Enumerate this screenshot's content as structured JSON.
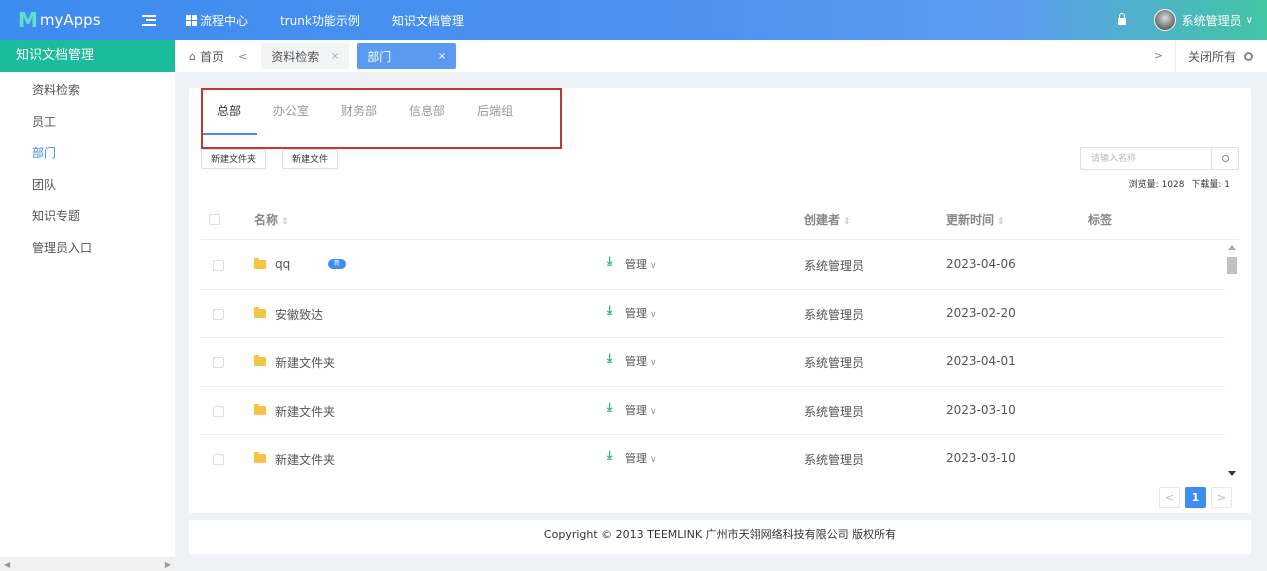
{
  "app": {
    "logo_mark": "M",
    "name": "myApps"
  },
  "topnav": [
    {
      "label": "流程中心",
      "icon": "grid-icon"
    },
    {
      "label": "trunk功能示例"
    },
    {
      "label": "知识文档管理"
    }
  ],
  "user": {
    "name": "系统管理员",
    "caret": "∨"
  },
  "sidebar": {
    "title": "知识文档管理",
    "items": [
      {
        "label": "资料检索"
      },
      {
        "label": "员工"
      },
      {
        "label": "部门"
      },
      {
        "label": "团队"
      },
      {
        "label": "知识专题"
      },
      {
        "label": "管理员入口"
      }
    ],
    "active_index": 2
  },
  "tabs": {
    "home": "首页",
    "pages": [
      {
        "label": "资料检索",
        "close": "×"
      },
      {
        "label": "部门",
        "close": "×"
      }
    ],
    "prev": "<",
    "next": ">",
    "close_all": "关闭所有"
  },
  "dept_tabs": [
    "总部",
    "办公室",
    "财务部",
    "信息部",
    "后端组"
  ],
  "toolbar": {
    "new_folder": "新建文件夹",
    "new_file": "新建文件"
  },
  "search": {
    "placeholder": "请输入名称"
  },
  "stats": {
    "views_label": "浏览量:",
    "views": "1028",
    "downloads_label": "下载量:",
    "downloads": "1"
  },
  "columns": {
    "name": "名称",
    "creator": "创建者",
    "time": "更新时间",
    "tag": "标签",
    "sort": "⇕"
  },
  "rows": [
    {
      "name": "qq",
      "badge": "新",
      "manage": "管理",
      "creator": "系统管理员",
      "time": "2023-04-06"
    },
    {
      "name": "安徽致达",
      "manage": "管理",
      "creator": "系统管理员",
      "time": "2023-02-20"
    },
    {
      "name": "新建文件夹",
      "manage": "管理",
      "creator": "系统管理员",
      "time": "2023-04-01"
    },
    {
      "name": "新建文件夹",
      "manage": "管理",
      "creator": "系统管理员",
      "time": "2023-03-10"
    },
    {
      "name": "新建文件夹",
      "manage": "管理",
      "creator": "系统管理员",
      "time": "2023-03-10"
    }
  ],
  "pager": {
    "prev": "<",
    "current": "1",
    "next": ">"
  },
  "footer": "Copyright © 2013 TEEMLINK 广州市天翎网络科技有限公司 版权所有",
  "colors": {
    "accent": "#3d8cf0",
    "sidebar_title": "#1bbc9b",
    "download": "#19be6b",
    "highlight_box": "#c0392b"
  }
}
